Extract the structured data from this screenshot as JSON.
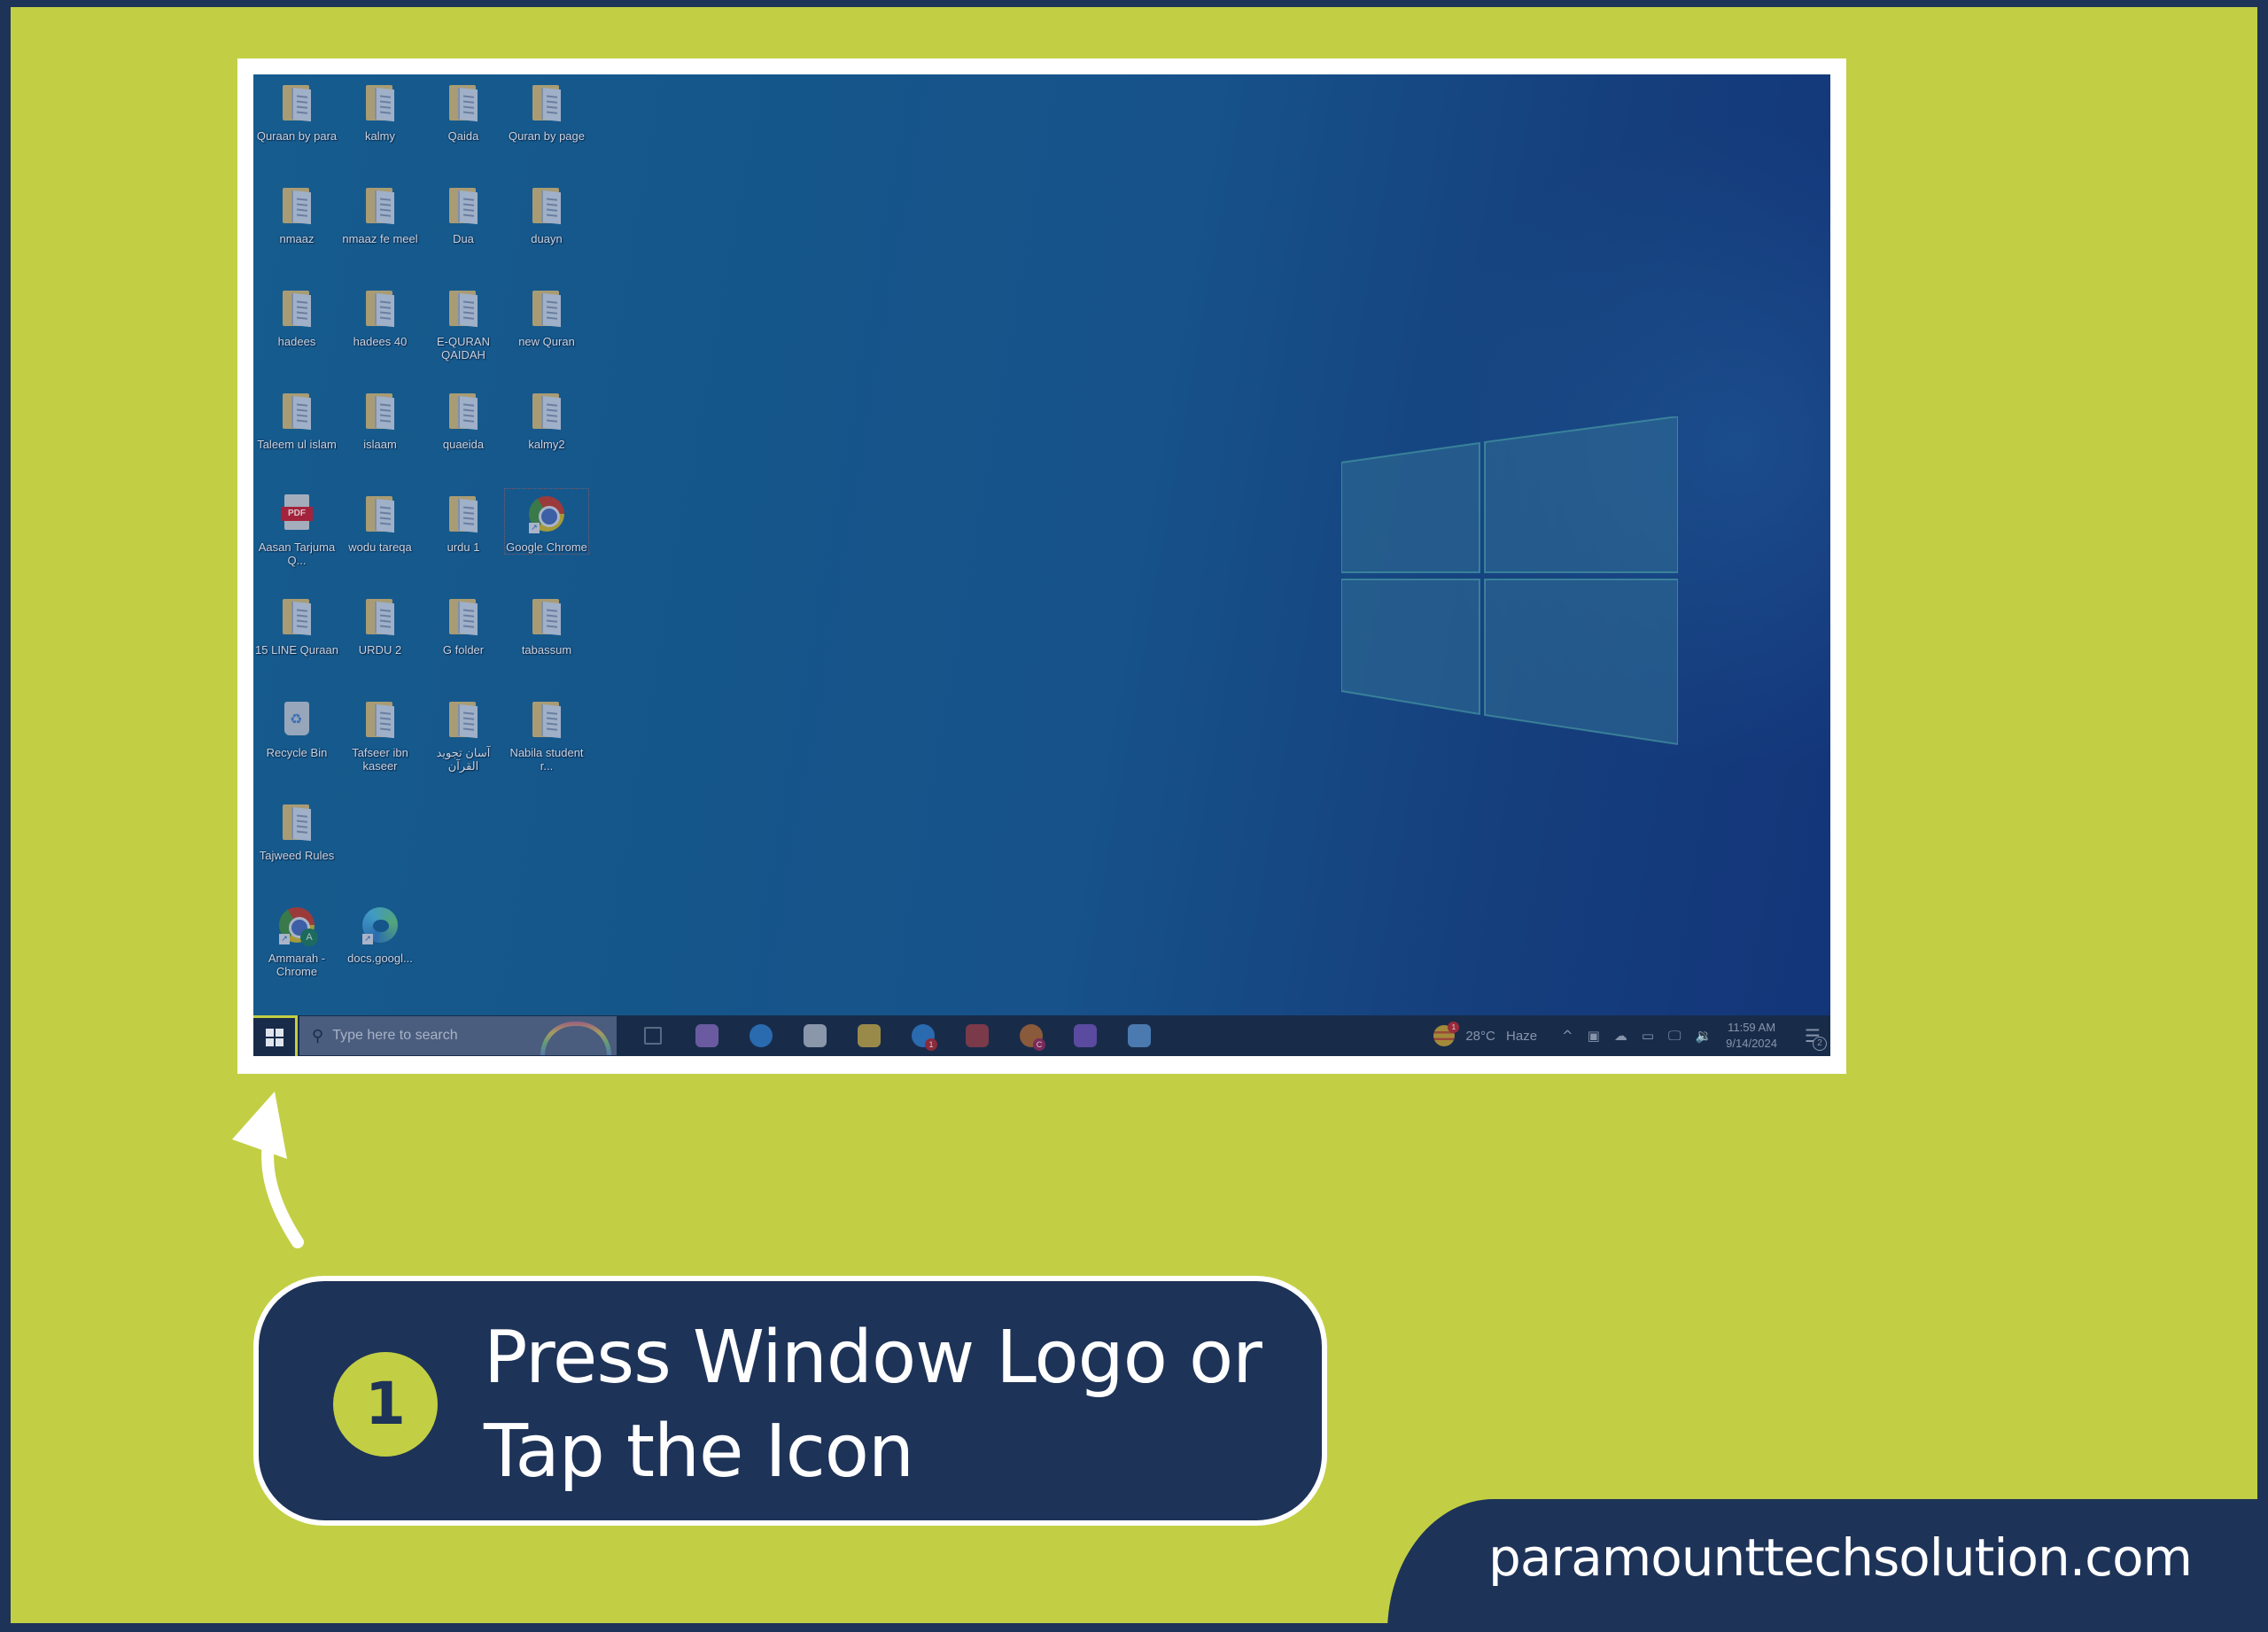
{
  "colors": {
    "accent_lime": "#c2cf44",
    "navy": "#1e3358",
    "white": "#ffffff",
    "desktop_blue": "#15558a",
    "taskbar": "#182c4a"
  },
  "desktop": {
    "icons": [
      {
        "label": "Quraan by para",
        "type": "folder"
      },
      {
        "label": "kalmy",
        "type": "folder"
      },
      {
        "label": "Qaida",
        "type": "folder"
      },
      {
        "label": "Quran by page",
        "type": "folder"
      },
      {
        "label": "nmaaz",
        "type": "folder"
      },
      {
        "label": "nmaaz fe meel",
        "type": "folder"
      },
      {
        "label": "Dua",
        "type": "folder"
      },
      {
        "label": "duayn",
        "type": "folder"
      },
      {
        "label": "hadees",
        "type": "folder"
      },
      {
        "label": "hadees 40",
        "type": "folder"
      },
      {
        "label": "E-QURAN QAIDAH",
        "type": "folder"
      },
      {
        "label": "new Quran",
        "type": "folder"
      },
      {
        "label": "Taleem ul islam",
        "type": "folder"
      },
      {
        "label": "islaam",
        "type": "folder"
      },
      {
        "label": "quaeida",
        "type": "folder"
      },
      {
        "label": "kalmy2",
        "type": "folder"
      },
      {
        "label": "Aasan Tarjuma Q...",
        "type": "pdf"
      },
      {
        "label": "wodu tareqa",
        "type": "folder"
      },
      {
        "label": "urdu 1",
        "type": "folder"
      },
      {
        "label": "Google Chrome",
        "type": "chrome"
      },
      {
        "label": "15 LINE Quraan",
        "type": "folder"
      },
      {
        "label": "URDU 2",
        "type": "folder"
      },
      {
        "label": "G folder",
        "type": "folder"
      },
      {
        "label": "tabassum",
        "type": "folder"
      },
      {
        "label": "Recycle Bin",
        "type": "recycle"
      },
      {
        "label": "Tafseer ibn kaseer",
        "type": "folder"
      },
      {
        "label": "آسان تجوید القرآن",
        "type": "folder"
      },
      {
        "label": "Nabila student r...",
        "type": "folder"
      },
      {
        "label": "Tajweed Rules",
        "type": "folder"
      },
      {
        "label": "Ammarah - Chrome",
        "type": "chrome-profile"
      },
      {
        "label": "docs.googl...",
        "type": "edge"
      }
    ]
  },
  "taskbar": {
    "search_placeholder": "Type here to search",
    "apps": [
      {
        "name": "task-view",
        "color": "#5a6a84"
      },
      {
        "name": "copilot",
        "color": "#6a5aa0"
      },
      {
        "name": "edge",
        "color": "#2a6bb0"
      },
      {
        "name": "mail",
        "color": "#8a96aa"
      },
      {
        "name": "file-explorer",
        "color": "#9a8a4a"
      },
      {
        "name": "skype",
        "color": "#2a6bb0",
        "badge": "1"
      },
      {
        "name": "snipping-tool",
        "color": "#7a3a4a"
      },
      {
        "name": "chrome",
        "color": "#8a5a3a",
        "badge": "C"
      },
      {
        "name": "paint",
        "color": "#5a4aa0"
      },
      {
        "name": "control-panel",
        "color": "#4a7ab0"
      }
    ],
    "weather": "28°C Haze",
    "time": "11:59 AM",
    "date": "9/14/2024",
    "notification_count": "2"
  },
  "callout": {
    "step_number": "1",
    "line1": "Press Window Logo or",
    "line2": "Tap the Icon"
  },
  "brand": {
    "website": "paramounttechsolution.com"
  }
}
